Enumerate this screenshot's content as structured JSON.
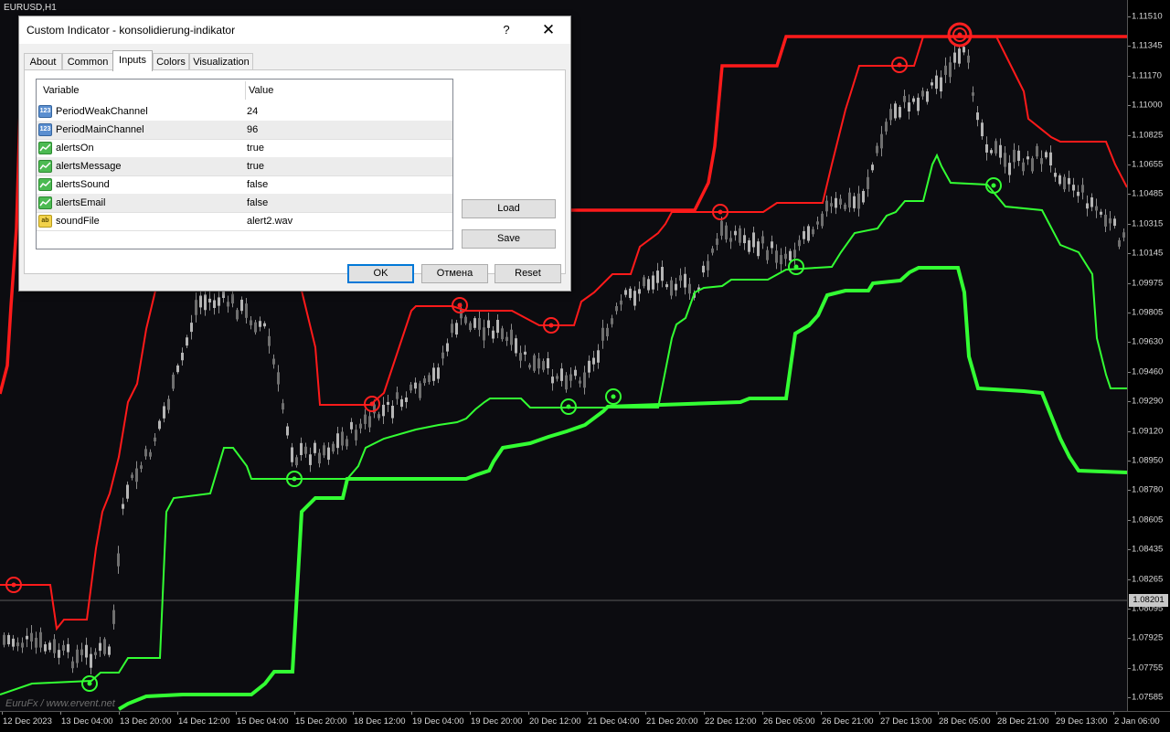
{
  "chart": {
    "symbol": "EURUSD,H1",
    "watermark": "EuruFx / www.ervent.net",
    "current_price": "1.08201",
    "price_labels": [
      "1.11510",
      "1.11345",
      "1.11170",
      "1.11000",
      "1.10825",
      "1.10655",
      "1.10485",
      "1.10315",
      "1.10145",
      "1.09975",
      "1.09805",
      "1.09630",
      "1.09460",
      "1.09290",
      "1.09120",
      "1.08950",
      "1.08780",
      "1.08605",
      "1.08435",
      "1.08265",
      "1.08095",
      "1.07925",
      "1.07755",
      "1.07585"
    ],
    "time_labels": [
      "12 Dec 2023",
      "13 Dec 04:00",
      "13 Dec 20:00",
      "14 Dec 12:00",
      "15 Dec 04:00",
      "15 Dec 20:00",
      "18 Dec 12:00",
      "19 Dec 04:00",
      "19 Dec 20:00",
      "20 Dec 12:00",
      "21 Dec 04:00",
      "21 Dec 20:00",
      "22 Dec 12:00",
      "26 Dec 05:00",
      "26 Dec 21:00",
      "27 Dec 13:00",
      "28 Dec 05:00",
      "28 Dec 21:00",
      "29 Dec 13:00",
      "2 Jan 06:00"
    ],
    "colors": {
      "background": "#0c0c10",
      "candles": "#9a9a9a",
      "upper_weak": "#ff1a1a",
      "upper_main": "#ff1a1a",
      "lower_weak": "#33ff33",
      "lower_main": "#33ff33"
    }
  },
  "dialog": {
    "title": "Custom Indicator - konsolidierung-indikator",
    "help_label": "?",
    "close_label": "✕",
    "tabs": [
      "About",
      "Common",
      "Inputs",
      "Colors",
      "Visualization"
    ],
    "active_tab": "Inputs",
    "columns": {
      "variable": "Variable",
      "value": "Value"
    },
    "params": [
      {
        "name": "PeriodWeakChannel",
        "value": "24",
        "icon": "number-icon",
        "icon_text": "123"
      },
      {
        "name": "PeriodMainChannel",
        "value": "96",
        "icon": "number-icon",
        "icon_text": "123"
      },
      {
        "name": "alertsOn",
        "value": "true",
        "icon": "boolean-icon",
        "icon_text": ""
      },
      {
        "name": "alertsMessage",
        "value": "true",
        "icon": "boolean-icon",
        "icon_text": ""
      },
      {
        "name": "alertsSound",
        "value": "false",
        "icon": "boolean-icon",
        "icon_text": ""
      },
      {
        "name": "alertsEmail",
        "value": "false",
        "icon": "boolean-icon",
        "icon_text": ""
      },
      {
        "name": "soundFile",
        "value": "alert2.wav",
        "icon": "string-icon",
        "icon_text": "ab"
      }
    ],
    "buttons": {
      "load": "Load",
      "save": "Save",
      "ok": "OK",
      "cancel": "Отмена",
      "reset": "Reset"
    }
  }
}
